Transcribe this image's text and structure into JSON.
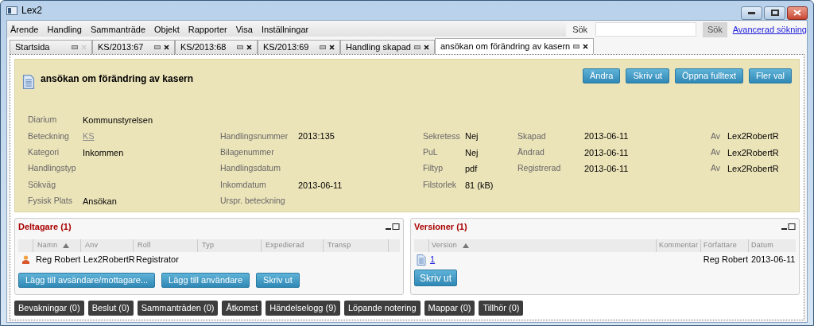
{
  "window": {
    "title": "Lex2"
  },
  "menu": [
    "Ärende",
    "Handling",
    "Sammanträde",
    "Objekt",
    "Rapporter",
    "Visa",
    "Inställningar"
  ],
  "search": {
    "label": "Sök",
    "button": "Sök",
    "link": "Avancerad sökning"
  },
  "tabs": [
    {
      "label": "Startsida",
      "selected": false,
      "closable": false
    },
    {
      "label": "KS/2013:67",
      "selected": false,
      "closable": true
    },
    {
      "label": "KS/2013:68",
      "selected": false,
      "closable": true
    },
    {
      "label": "KS/2013:69",
      "selected": false,
      "closable": true
    },
    {
      "label": "Handling skapad",
      "selected": false,
      "closable": true
    },
    {
      "label": "ansökan om förändring av kasern",
      "selected": true,
      "closable": true
    }
  ],
  "document": {
    "title": "ansökan om förändring av kasern",
    "buttons": [
      "Ändra",
      "Skriv ut",
      "Öppna fulltext",
      "Fler val"
    ],
    "fields": {
      "column_1": [
        {
          "label": "Diarium",
          "value": "Kommunstyrelsen"
        },
        {
          "label": "Beteckning",
          "value": "KS",
          "link": true
        },
        {
          "label": "Kategori",
          "value": "Inkommen"
        },
        {
          "label": "Handlingstyp"
        },
        {
          "label": "Sökväg"
        },
        {
          "label": "Fysisk Plats",
          "value": "Ansökan"
        }
      ],
      "column_2": [
        {
          "label": "Handlingsnummer",
          "value": "2013:135"
        },
        {
          "label": "Bilagenummer"
        },
        {
          "label": "Handlingsdatum"
        },
        {
          "label": "Inkomdatum",
          "value": "2013-06-11"
        },
        {
          "label": "Urspr. beteckning"
        }
      ],
      "column_3": [
        {
          "label": "Sekretess",
          "value": "Nej"
        },
        {
          "label": "PuL",
          "value": "Nej"
        },
        {
          "label": "Filtyp",
          "value": "pdf"
        },
        {
          "label": "Filstorlek",
          "value": "81 (kB)"
        }
      ],
      "column_4": [
        {
          "label": "Skapad",
          "value": "2013-06-11"
        },
        {
          "label": "Ändrad",
          "value": "2013-06-11"
        },
        {
          "label": "Registrerad",
          "value": "2013-06-11"
        }
      ],
      "column_5": [
        {
          "label": "Av",
          "value": "Lex2RobertR"
        },
        {
          "label": "Av",
          "value": "Lex2RobertR"
        },
        {
          "label": "Av",
          "value": "Lex2RobertR"
        }
      ]
    }
  },
  "participants": {
    "title": "Deltagare (1)",
    "columns": [
      "Namn",
      "Anv",
      "Roll",
      "Typ",
      "Expedierad",
      "Transp"
    ],
    "rows": [
      [
        "Reg Robert",
        "Lex2RobertR",
        "Registrator"
      ]
    ],
    "buttons": [
      "Lägg till avsändare/mottagare...",
      "Lägg till användare",
      "Skriv ut"
    ]
  },
  "versions": {
    "title": "Versioner (1)",
    "columns": [
      "Version",
      "Kommentar",
      "Författare",
      "Datum"
    ],
    "rows": [
      {
        "version": "1",
        "author": "Reg Robert",
        "date": "2013-06-11"
      }
    ],
    "buttons": [
      "Skriv ut"
    ]
  },
  "bottom_tabs": [
    "Bevakningar (0)",
    "Beslut (0)",
    "Sammanträden (0)",
    "Åtkomst",
    "Händelselogg (9)",
    "Löpande notering",
    "Mappar (0)",
    "Tillhör (0)"
  ]
}
